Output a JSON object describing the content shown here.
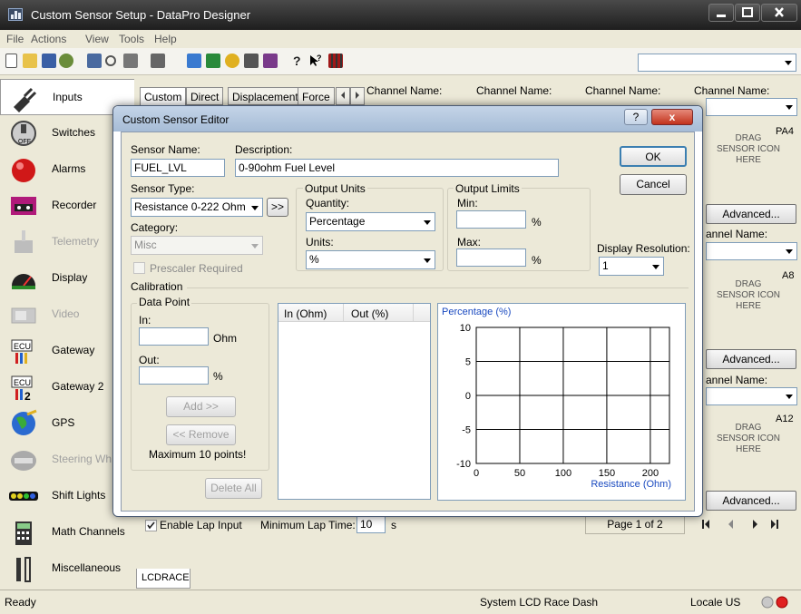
{
  "window": {
    "title": "Custom Sensor Setup - DataPro Designer"
  },
  "menu": [
    "File",
    "Actions",
    "View",
    "Tools",
    "Help"
  ],
  "sidebar": {
    "items": [
      {
        "label": "Inputs",
        "icon": "inputs-plug-icon"
      },
      {
        "label": "Switches",
        "icon": "switch-icon"
      },
      {
        "label": "Alarms",
        "icon": "alarm-icon"
      },
      {
        "label": "Recorder",
        "icon": "recorder-icon"
      },
      {
        "label": "Telemetry",
        "icon": "telemetry-icon"
      },
      {
        "label": "Display",
        "icon": "gauge-display-icon"
      },
      {
        "label": "Video",
        "icon": "video-icon"
      },
      {
        "label": "Gateway",
        "icon": "ecu-gateway-icon"
      },
      {
        "label": "Gateway 2",
        "icon": "ecu-gateway2-icon"
      },
      {
        "label": "GPS",
        "icon": "gps-globe-icon"
      },
      {
        "label": "Steering Wh",
        "icon": "steering-wheel-icon"
      },
      {
        "label": "Shift Lights",
        "icon": "shift-lights-icon"
      },
      {
        "label": "Math Channels",
        "icon": "calculator-icon"
      },
      {
        "label": "Miscellaneous",
        "icon": "tools-icon"
      }
    ]
  },
  "tabs": [
    "Custom",
    "Direct",
    "Displacement",
    "Force"
  ],
  "channel_label": "Channel Name:",
  "channel_label_clipped": "annel Name:",
  "drag_text": "DRAG SENSOR ICON HERE",
  "advanced_label": "Advanced...",
  "pins": [
    "PA4",
    "A8",
    "A12"
  ],
  "bottom": {
    "enable_lap": "Enable Lap Input",
    "min_lap_label": "Minimum Lap Time:",
    "min_lap_value": "10",
    "min_lap_unit": "s",
    "page": "Page 1 of 2",
    "sheet_tab": "LCDRACE"
  },
  "status": {
    "ready": "Ready",
    "system": "System  LCD Race Dash",
    "locale": "Locale  US"
  },
  "dialog": {
    "title": "Custom Sensor Editor",
    "help": "?",
    "close": "x",
    "sensor_name_label": "Sensor Name:",
    "sensor_name": "FUEL_LVL",
    "description_label": "Description:",
    "description": "0-90ohm Fuel Level",
    "sensor_type_label": "Sensor Type:",
    "sensor_type": "Resistance 0-222 Ohm",
    "copy_btn": ">>",
    "category_label": "Category:",
    "category": "Misc",
    "prescaler": "Prescaler Required",
    "output_units_label": "Output Units",
    "quantity_label": "Quantity:",
    "quantity": "Percentage",
    "units_label": "Units:",
    "units": "%",
    "output_limits_label": "Output Limits",
    "min_label": "Min:",
    "max_label": "Max:",
    "pct": "%",
    "display_resolution_label": "Display Resolution:",
    "display_resolution": "1",
    "ok": "OK",
    "cancel": "Cancel",
    "calibration_label": "Calibration",
    "data_point_label": "Data Point",
    "in_label": "In:",
    "in_unit": "Ohm",
    "out_label": "Out:",
    "out_unit": "%",
    "add_btn": "Add >>",
    "remove_btn": "<< Remove",
    "max_points": "Maximum 10 points!",
    "delete_all": "Delete All",
    "col_in": "In (Ohm)",
    "col_out": "Out (%)"
  },
  "chart_data": {
    "type": "line",
    "ylabel": "Percentage (%)",
    "xlabel": "Resistance (Ohm)",
    "xlim": [
      0,
      222
    ],
    "ylim": [
      -10,
      10
    ],
    "xticks": [
      0,
      50,
      100,
      150,
      200
    ],
    "yticks": [
      10,
      5,
      0,
      -5,
      -10
    ],
    "grid": true,
    "series": []
  }
}
